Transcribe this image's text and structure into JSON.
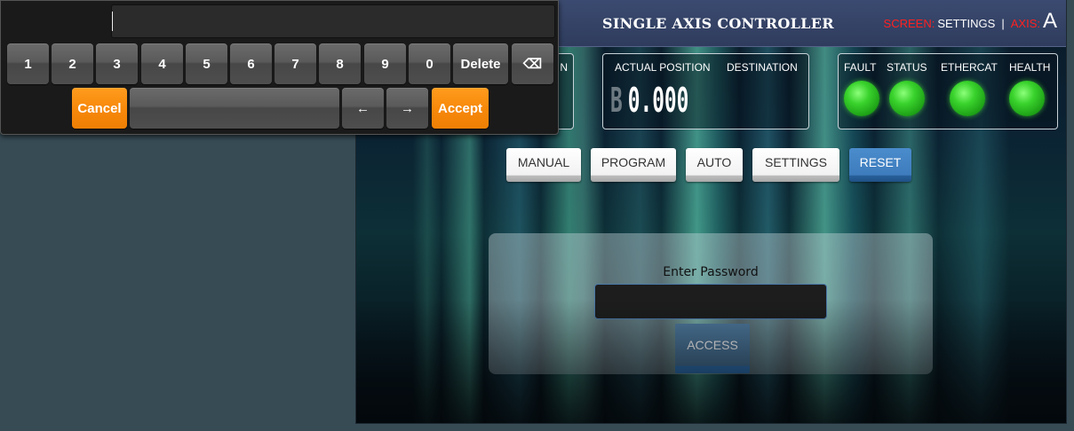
{
  "header": {
    "title": "SINGLE AXIS CONTROLLER",
    "screen_label": "SCREEN:",
    "screen_value": "SETTINGS",
    "separator": "|",
    "axis_label": "AXIS:",
    "axis_value": "A"
  },
  "position_panel": {
    "partial_label": "N",
    "actual_position_label": "ACTUAL POSITION",
    "destination_label": "DESTINATION",
    "axis_letter": "B",
    "position_value": "0.000"
  },
  "status_panel": {
    "indicators": [
      {
        "label": "FAULT",
        "state_color": "#39d22c"
      },
      {
        "label": "STATUS",
        "state_color": "#39d22c"
      },
      {
        "label": "ETHERCAT",
        "state_color": "#39d22c"
      },
      {
        "label": "HEALTH",
        "state_color": "#39d22c"
      }
    ]
  },
  "nav": {
    "manual": "MANUAL",
    "program": "PROGRAM",
    "auto": "AUTO",
    "settings": "SETTINGS",
    "reset": "RESET"
  },
  "login": {
    "prompt": "Enter Password",
    "password_value": "",
    "access_label": "ACCESS"
  },
  "keyboard": {
    "preview_value": "",
    "digits": [
      "1",
      "2",
      "3",
      "4",
      "5",
      "6",
      "7",
      "8",
      "9",
      "0"
    ],
    "delete_label": "Delete",
    "backspace_label": "⌫",
    "cancel_label": "Cancel",
    "space_label": "",
    "left_label": "←",
    "right_label": "→",
    "accept_label": "Accept"
  },
  "colors": {
    "accent_orange": "#f7890b",
    "title_bar": "#36456a",
    "active_button": "#3e7cbd",
    "led_ok": "#39d22c",
    "axis_red": "#ff2020"
  }
}
